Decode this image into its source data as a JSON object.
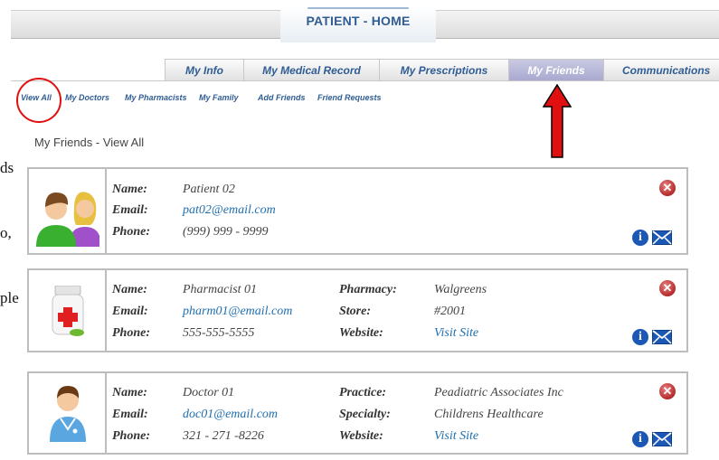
{
  "doc_fragments": [
    "ds",
    "o,",
    "ple"
  ],
  "header": {
    "title": "PATIENT - HOME"
  },
  "tabs": [
    {
      "label": "My Info",
      "active": false
    },
    {
      "label": "My Medical Record",
      "active": false
    },
    {
      "label": "My Prescriptions",
      "active": false
    },
    {
      "label": "My Friends",
      "active": true
    },
    {
      "label": "Communications",
      "active": false
    }
  ],
  "subnav": [
    "View All",
    "My Doctors",
    "My Pharmacists",
    "My Family",
    "Add Friends",
    "Friend Requests"
  ],
  "section_title": "My Friends - View All",
  "labels": {
    "name": "Name:",
    "email": "Email:",
    "phone": "Phone:",
    "pharmacy": "Pharmacy:",
    "store": "Store:",
    "website": "Website:",
    "practice": "Practice:",
    "specialty": "Specialty:"
  },
  "friends": [
    {
      "type": "family",
      "name": "Patient 02",
      "email": "pat02@email.com",
      "phone": "(999) 999 - 9999"
    },
    {
      "type": "pharmacist",
      "name": "Pharmacist 01",
      "email": "pharm01@email.com",
      "phone": "555-555-5555",
      "pharmacy": "Walgreens",
      "store": "#2001",
      "website": "Visit Site"
    },
    {
      "type": "doctor",
      "name": "Doctor 01",
      "email": "doc01@email.com",
      "phone": "321 - 271 -8226",
      "practice": "Peadiatric Associates Inc",
      "specialty": "Childrens Healthcare",
      "website": "Visit Site"
    }
  ],
  "icons": {
    "remove": "x-circle-icon",
    "info": "info-icon",
    "mail": "mail-icon",
    "annotation_circle": "#e01010",
    "annotation_arrow": "#e01010"
  }
}
